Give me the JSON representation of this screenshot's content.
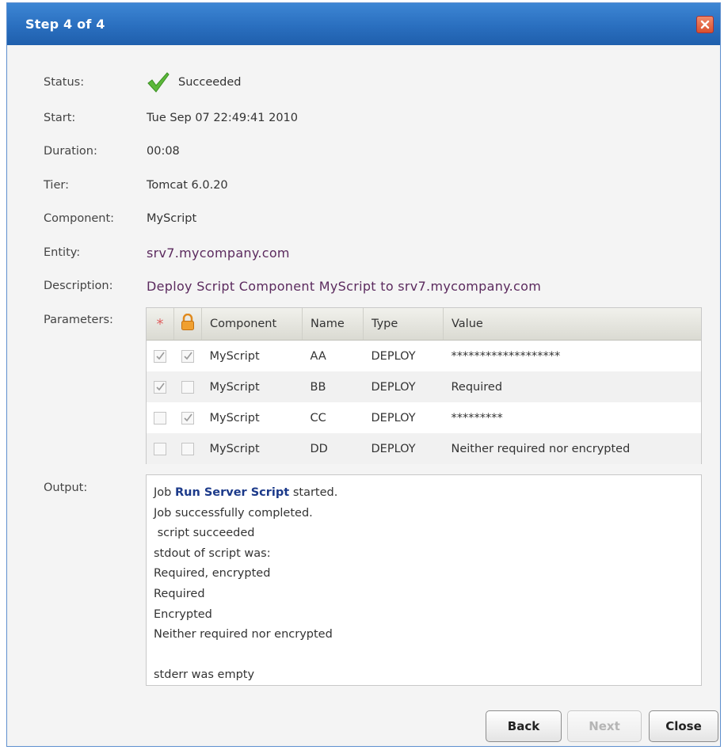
{
  "dialog": {
    "title": "Step 4 of 4"
  },
  "details": {
    "status_label": "Status:",
    "status_value": "Succeeded",
    "start_label": "Start:",
    "start_value": "Tue Sep 07 22:49:41 2010",
    "duration_label": "Duration:",
    "duration_value": "00:08",
    "tier_label": "Tier:",
    "tier_value": "Tomcat 6.0.20",
    "component_label": "Component:",
    "component_value": "MyScript",
    "entity_label": "Entity:",
    "entity_value": "srv7.mycompany.com",
    "description_label": "Description:",
    "description_value": "Deploy Script Component MyScript to srv7.mycompany.com"
  },
  "parameters": {
    "label": "Parameters:",
    "required_header": "*",
    "columns": [
      "Component",
      "Name",
      "Type",
      "Value"
    ],
    "rows": [
      {
        "required": true,
        "encrypted": true,
        "component": "MyScript",
        "name": "AA",
        "type": "DEPLOY",
        "value": "*******************"
      },
      {
        "required": true,
        "encrypted": false,
        "component": "MyScript",
        "name": "BB",
        "type": "DEPLOY",
        "value": "Required"
      },
      {
        "required": false,
        "encrypted": true,
        "component": "MyScript",
        "name": "CC",
        "type": "DEPLOY",
        "value": "*********"
      },
      {
        "required": false,
        "encrypted": false,
        "component": "MyScript",
        "name": "DD",
        "type": "DEPLOY",
        "value": "Neither required nor encrypted"
      }
    ]
  },
  "output": {
    "label": "Output:",
    "line1_prefix": "Job ",
    "job_name": "Run Server Script",
    "line1_suffix": " started.",
    "lines": [
      "Job successfully completed.",
      " script succeeded",
      "stdout of script was:",
      "Required, encrypted",
      "Required",
      "Encrypted",
      "Neither required nor encrypted",
      "",
      "stderr was empty"
    ]
  },
  "buttons": {
    "back": "Back",
    "next": "Next",
    "close": "Close"
  },
  "icons": {
    "status": "check-icon",
    "encrypted_header": "lock-icon",
    "close": "close-icon"
  },
  "colors": {
    "titlebar": "#2a6fbf",
    "success": "#4caf32",
    "link": "#1c3a8a"
  }
}
